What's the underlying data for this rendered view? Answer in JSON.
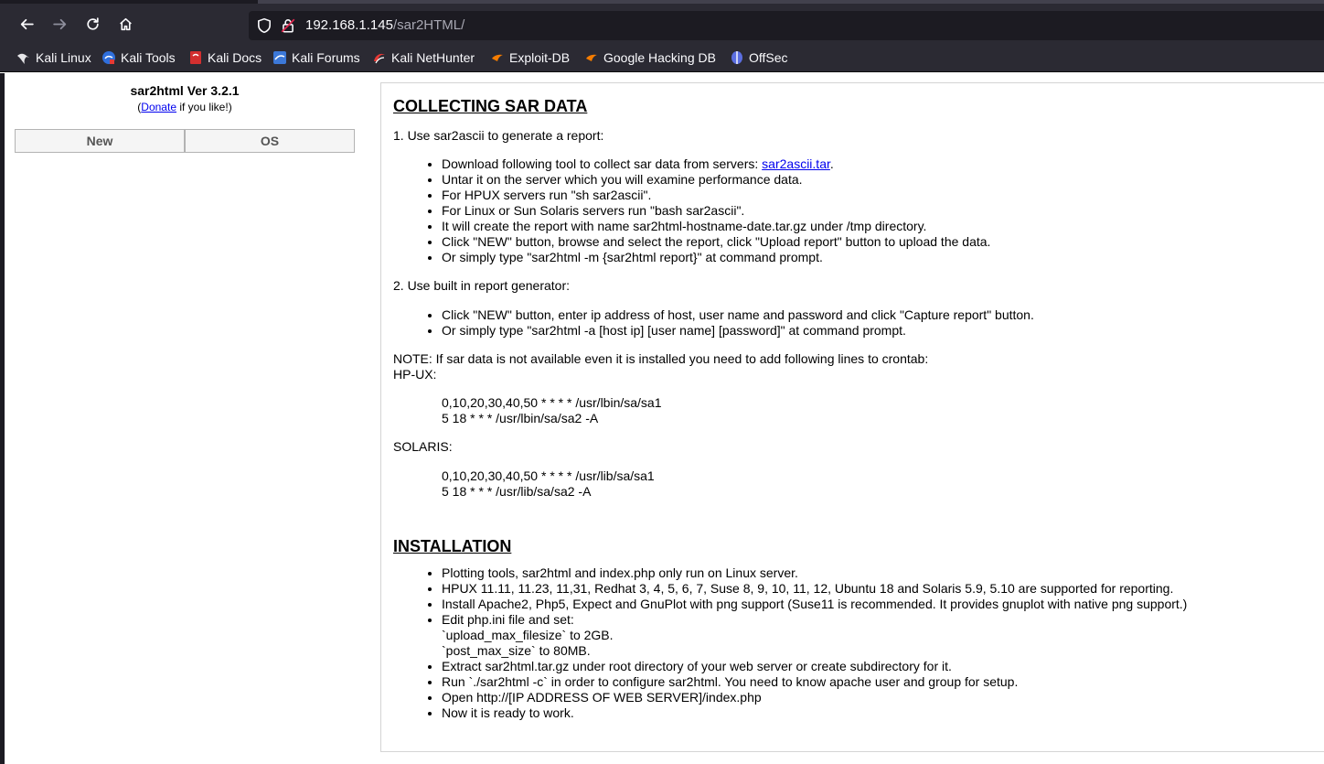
{
  "browser": {
    "url_host": "192.168.1.145",
    "url_path": "/sar2HTML/",
    "bookmarks": [
      {
        "label": "Kali Linux",
        "icon": "kali-dragon-icon"
      },
      {
        "label": "Kali Tools",
        "icon": "kali-tools-icon"
      },
      {
        "label": "Kali Docs",
        "icon": "kali-docs-icon"
      },
      {
        "label": "Kali Forums",
        "icon": "kali-forums-icon"
      },
      {
        "label": "Kali NetHunter",
        "icon": "nethunter-icon"
      },
      {
        "label": "Exploit-DB",
        "icon": "exploit-db-icon"
      },
      {
        "label": "Google Hacking DB",
        "icon": "ghdb-icon"
      },
      {
        "label": "OffSec",
        "icon": "offsec-icon"
      }
    ]
  },
  "sidebar": {
    "title": "sar2html Ver 3.2.1",
    "donate_prefix": "(",
    "donate_link": "Donate",
    "donate_suffix": " if you like!)",
    "buttons": {
      "new": "New",
      "os": "OS"
    }
  },
  "main": {
    "collect_heading": "COLLECTING SAR DATA",
    "step1": "1. Use sar2ascii to generate a report:",
    "step1_item0_prefix": "Download following tool to collect sar data from servers: ",
    "step1_item0_link": "sar2ascii.tar",
    "step1_item0_suffix": ".",
    "step1_items": [
      "Untar it on the server which you will examine performance data.",
      "For HPUX servers run \"sh sar2ascii\".",
      "For Linux or Sun Solaris servers run \"bash sar2ascii\".",
      "It will create the report with name sar2html-hostname-date.tar.gz under /tmp directory.",
      "Click \"NEW\" button, browse and select the report, click \"Upload report\" button to upload the data.",
      "Or simply type \"sar2html -m {sar2html report}\" at command prompt."
    ],
    "step2": "2. Use built in report generator:",
    "step2_items": [
      "Click \"NEW\" button, enter ip address of host, user name and password and click \"Capture report\" button.",
      "Or simply type \"sar2html -a [host ip] [user name] [password]\" at command prompt."
    ],
    "note": "NOTE: If sar data is not available even it is installed you need to add following lines to crontab:",
    "hpux_label": "HP-UX:",
    "hpux_lines": [
      "0,10,20,30,40,50 * * * * /usr/lbin/sa/sa1",
      "5 18 * * * /usr/lbin/sa/sa2 -A"
    ],
    "solaris_label": "SOLARIS:",
    "solaris_lines": [
      "0,10,20,30,40,50 * * * * /usr/lib/sa/sa1",
      "5 18 * * * /usr/lib/sa/sa2 -A"
    ],
    "install_heading": "INSTALLATION",
    "install_items": [
      "Plotting tools, sar2html and index.php only run on Linux server.",
      "HPUX 11.11, 11.23, 11,31, Redhat 3, 4, 5, 6, 7, Suse 8, 9, 10, 11, 12, Ubuntu 18 and Solaris 5.9, 5.10 are supported for reporting.",
      "Install Apache2, Php5, Expect and GnuPlot with png support (Suse11 is recommended. It provides gnuplot with native png support.)"
    ],
    "install_phpini": "Edit php.ini file and set:",
    "install_phpini_line1": "`upload_max_filesize` to 2GB.",
    "install_phpini_line2": "`post_max_size` to 80MB.",
    "install_items_after": [
      "Extract sar2html.tar.gz under root directory of your web server or create subdirectory for it.",
      "Run `./sar2html -c` in order to configure sar2html. You need to know apache user and group for setup.",
      "Open http://[IP ADDRESS OF WEB SERVER]/index.php",
      "Now it is ready to work."
    ]
  }
}
